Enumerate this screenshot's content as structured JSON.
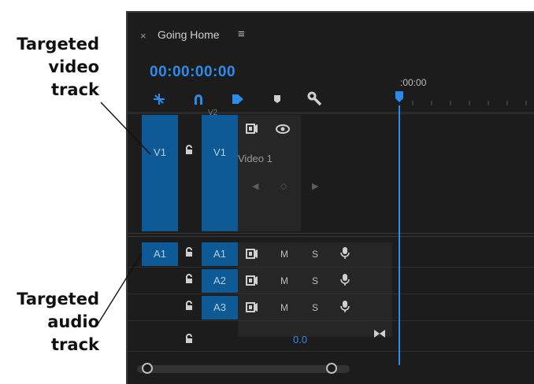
{
  "callouts": {
    "video": [
      "Targeted",
      "video",
      "track"
    ],
    "audio": [
      "Targeted",
      "audio",
      "track"
    ]
  },
  "sequence": {
    "tab_close": "×",
    "tab_title": "Going Home",
    "tab_menu": "≡",
    "timecode": "00:00:00:00",
    "ruler_time": ":00:00"
  },
  "tracks": {
    "video": {
      "source_label": "V1",
      "target_label": "V1",
      "name": "Video 1",
      "truncated_above": "V2"
    },
    "audio": [
      {
        "source_label": "A1",
        "target_label": "A1",
        "mute": "M",
        "solo": "S"
      },
      {
        "source_label": "",
        "target_label": "A2",
        "mute": "M",
        "solo": "S"
      },
      {
        "source_label": "",
        "target_label": "A3",
        "mute": "M",
        "solo": "S"
      }
    ],
    "master_volume": "0.0"
  },
  "icons": [
    "close-icon",
    "hamburger-menu-icon",
    "snap-icon",
    "linked-selection-icon",
    "add-marker-icon",
    "marker-icon",
    "wrench-icon",
    "lock-icon",
    "toggle-sync-lock-icon",
    "eye-icon",
    "microphone-icon",
    "keyframe-prev-icon",
    "keyframe-add-icon",
    "keyframe-next-icon",
    "playhead-icon",
    "bowtie-icon"
  ],
  "colors": {
    "accent": "#2d8ceb",
    "target_fill": "#0d5a96",
    "panel_bg": "#1c1c1c"
  }
}
